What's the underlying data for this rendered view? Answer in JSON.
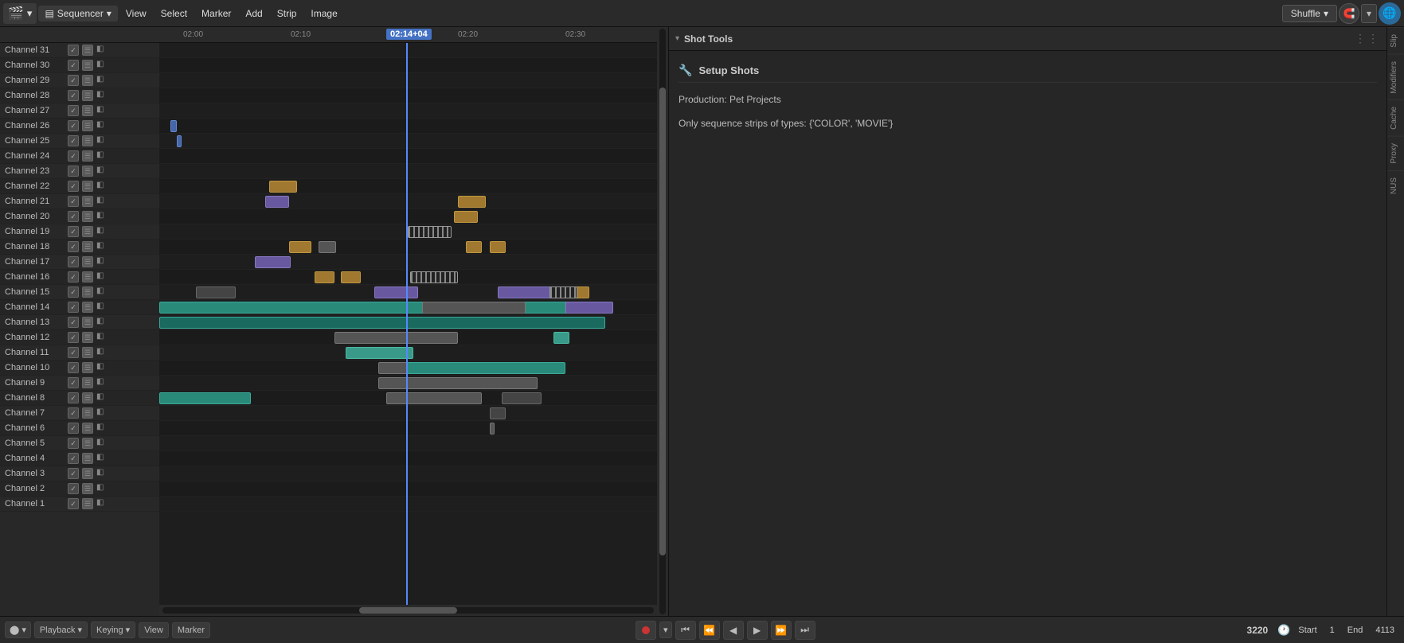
{
  "app": {
    "title": "Sequencer",
    "editor_icon": "⬜",
    "editor_dropdown": "▾"
  },
  "menu": {
    "items": [
      "View",
      "Select",
      "Marker",
      "Add",
      "Strip",
      "Image"
    ]
  },
  "shuffle": {
    "label": "Shuffle",
    "dropdown": "▾"
  },
  "playhead": {
    "time": "02:14+04",
    "line_pct": 53
  },
  "ruler": {
    "marks": [
      "02:00",
      "02:10",
      "02:20",
      "02:30"
    ]
  },
  "channels": [
    {
      "name": "Channel 31"
    },
    {
      "name": "Channel 30"
    },
    {
      "name": "Channel 29"
    },
    {
      "name": "Channel 28"
    },
    {
      "name": "Channel 27"
    },
    {
      "name": "Channel 26"
    },
    {
      "name": "Channel 25"
    },
    {
      "name": "Channel 24"
    },
    {
      "name": "Channel 23"
    },
    {
      "name": "Channel 22"
    },
    {
      "name": "Channel 21"
    },
    {
      "name": "Channel 20"
    },
    {
      "name": "Channel 19"
    },
    {
      "name": "Channel 18"
    },
    {
      "name": "Channel 17"
    },
    {
      "name": "Channel 16"
    },
    {
      "name": "Channel 15"
    },
    {
      "name": "Channel 14"
    },
    {
      "name": "Channel 13"
    },
    {
      "name": "Channel 12"
    },
    {
      "name": "Channel 11"
    },
    {
      "name": "Channel 10"
    },
    {
      "name": "Channel 9"
    },
    {
      "name": "Channel 8"
    },
    {
      "name": "Channel 7"
    },
    {
      "name": "Channel 6"
    },
    {
      "name": "Channel 5"
    },
    {
      "name": "Channel 4"
    },
    {
      "name": "Channel 3"
    },
    {
      "name": "Channel 2"
    },
    {
      "name": "Channel 1"
    }
  ],
  "right_panel": {
    "title": "Shot Tools",
    "collapse_icon": "▾",
    "dots": "⋮⋮",
    "setup_shots": "Setup Shots",
    "production_label": "Production: Pet Projects",
    "sequence_info": "Only sequence strips of types: {'COLOR', 'MOVIE'}"
  },
  "side_tabs": [
    "Slip",
    "Modifiers",
    "Cache",
    "Proxy",
    "NUS"
  ],
  "bottom_bar": {
    "playback_label": "Playback",
    "keying_label": "Keying",
    "view_label": "View",
    "marker_label": "Marker",
    "frame_number": "3220",
    "start_label": "Start",
    "start_value": "1",
    "end_label": "End",
    "end_value": "4113"
  },
  "transport": {
    "jump_start": "⏮",
    "step_back_far": "⏪",
    "step_back": "◀",
    "play": "▶",
    "step_fwd": "▶▶",
    "jump_end": "⏭"
  }
}
